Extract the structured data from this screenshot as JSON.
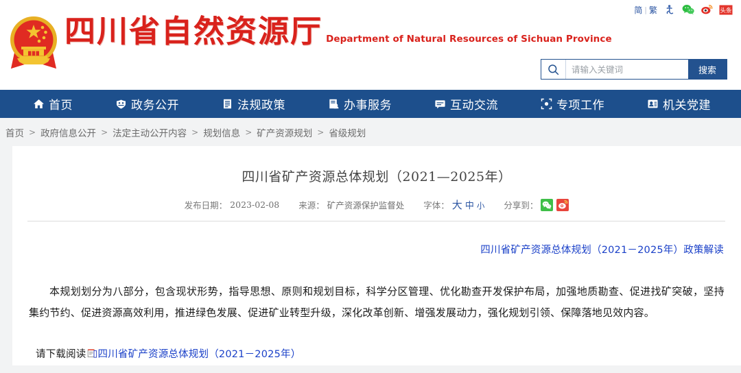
{
  "utility": {
    "lang_simplified": "简",
    "lang_separator": "|",
    "lang_traditional": "繁",
    "icons": [
      "accessibility-icon",
      "wechat-icon",
      "weibo-icon",
      "toutiao-icon"
    ],
    "toutiao_label": "头条"
  },
  "brand": {
    "emblem": "china-national-emblem",
    "name_cn": "四川省自然资源厅",
    "name_en": "Department of Natural Resources of Sichuan Province",
    "color": "#d9221c"
  },
  "search": {
    "placeholder": "请输入关键词",
    "value": "",
    "button_label": "搜索",
    "icon": "search-icon",
    "accent": "#23528f"
  },
  "nav": {
    "background": "#1d4f8c",
    "items": [
      {
        "label": "首页",
        "icon": "home-icon"
      },
      {
        "label": "政务公开",
        "icon": "shield-icon"
      },
      {
        "label": "法规政策",
        "icon": "document-icon"
      },
      {
        "label": "办事服务",
        "icon": "form-user-icon"
      },
      {
        "label": "互动交流",
        "icon": "chat-icon"
      },
      {
        "label": "专项工作",
        "icon": "target-icon"
      },
      {
        "label": "机关党建",
        "icon": "badge-icon"
      }
    ]
  },
  "breadcrumb": {
    "separator": ">",
    "items": [
      "首页",
      "政府信息公开",
      "法定主动公开内容",
      "规划信息",
      "矿产资源规划",
      "省级规划"
    ]
  },
  "article": {
    "title": "四川省矿产资源总体规划（2021—2025年）",
    "meta": {
      "date_label": "发布日期：",
      "date_value": "2023-02-08",
      "source_label": "来源：",
      "source_value": "矿产资源保护监督处",
      "fontsize_label": "字体：",
      "fontsize_large": "大",
      "fontsize_medium": "中",
      "fontsize_small": "小",
      "share_label": "分享到：",
      "share_icons": [
        "wechat-share-icon",
        "weibo-share-icon"
      ]
    },
    "policy_link": "四川省矿产资源总体规划（2021－2025年）政策解读",
    "body": "本规划划分为八部分，包含现状形势，指导思想、原则和规划目标，科学分区管理、优化勘查开发保护布局，加强地质勘查、促进找矿突破，坚持集约节约、促进资源高效利用，推进绿色发展、促进矿业转型升级，深化改革创新、增强发展动力，强化规划引领、保障落地见效内容。",
    "download_prefix": "请下载阅读",
    "download_icon": "attachment-document-icon",
    "download_link": "四川省矿产资源总体规划（2021－2025年）",
    "link_color": "#1a40c8"
  }
}
